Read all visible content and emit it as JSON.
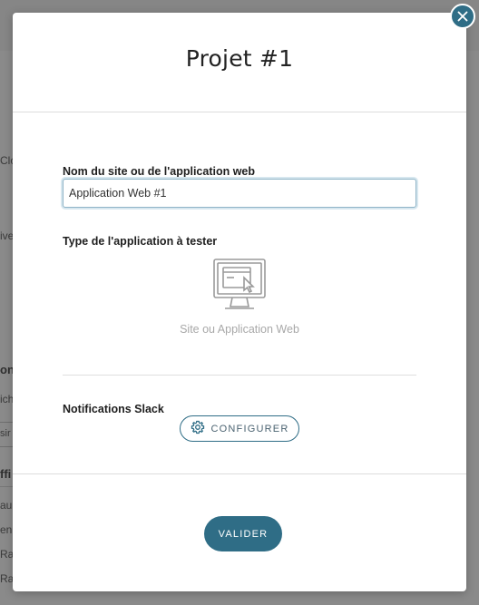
{
  "background": {
    "fragments": [
      "Clo",
      "ive",
      "ons",
      "ich",
      "sir",
      "ffi",
      "au",
      "en",
      "Rap",
      "Rap"
    ]
  },
  "modal": {
    "title": "Projet #1",
    "close_icon": "close-icon",
    "site_name": {
      "label": "Nom du site ou de l'application web",
      "value": "Application Web #1"
    },
    "app_type": {
      "label": "Type de l'application à tester",
      "option_icon": "monitor-cursor-icon",
      "option_label": "Site ou Application Web"
    },
    "slack": {
      "label": "Notifications Slack",
      "button_icon": "gear-icon",
      "button_label": "CONFIGURER"
    },
    "validate_label": "VALIDER"
  },
  "colors": {
    "accent": "#2f6d86",
    "overlay": "#8a8a8a"
  }
}
